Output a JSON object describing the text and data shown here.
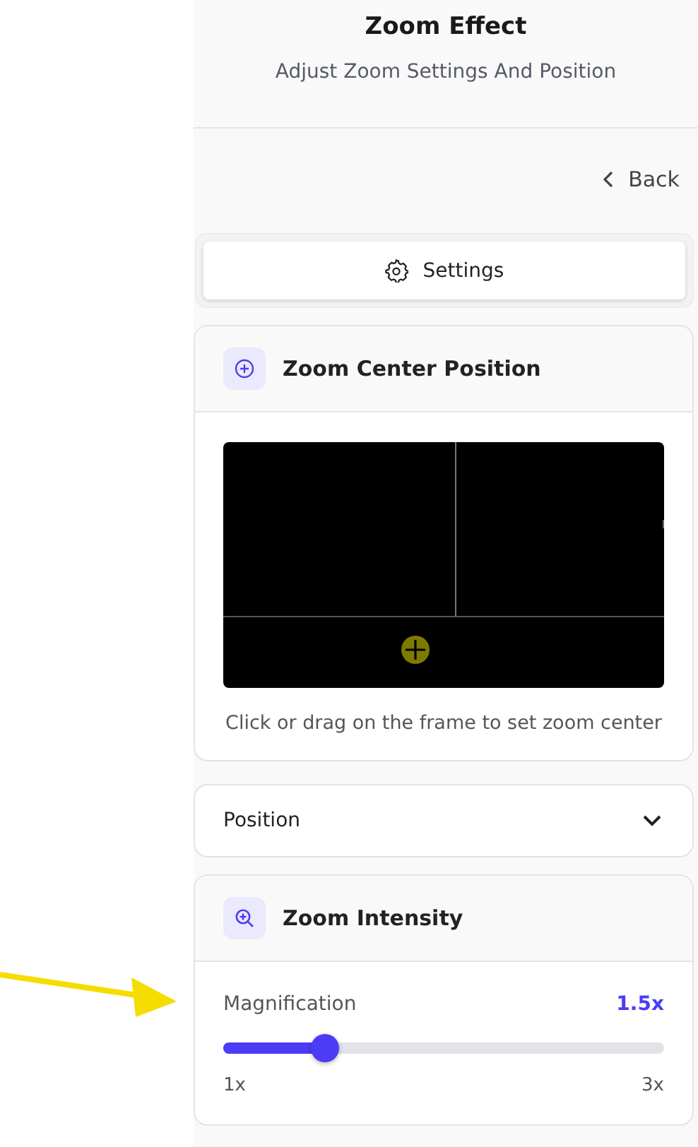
{
  "header": {
    "title": "Zoom Effect",
    "subtitle": "Adjust Zoom Settings And Position"
  },
  "back": {
    "label": "Back"
  },
  "tabs": [
    {
      "label": "Settings",
      "selected": true
    }
  ],
  "center_card": {
    "title": "Zoom Center Position",
    "caption": "Click or drag on the frame to set zoom center"
  },
  "position_section": {
    "label": "Position",
    "expanded": false
  },
  "intensity_card": {
    "title": "Zoom Intensity",
    "label": "Magnification",
    "value": "1.5x",
    "level": 0.23,
    "min_label": "1x",
    "max_label": "3x"
  }
}
